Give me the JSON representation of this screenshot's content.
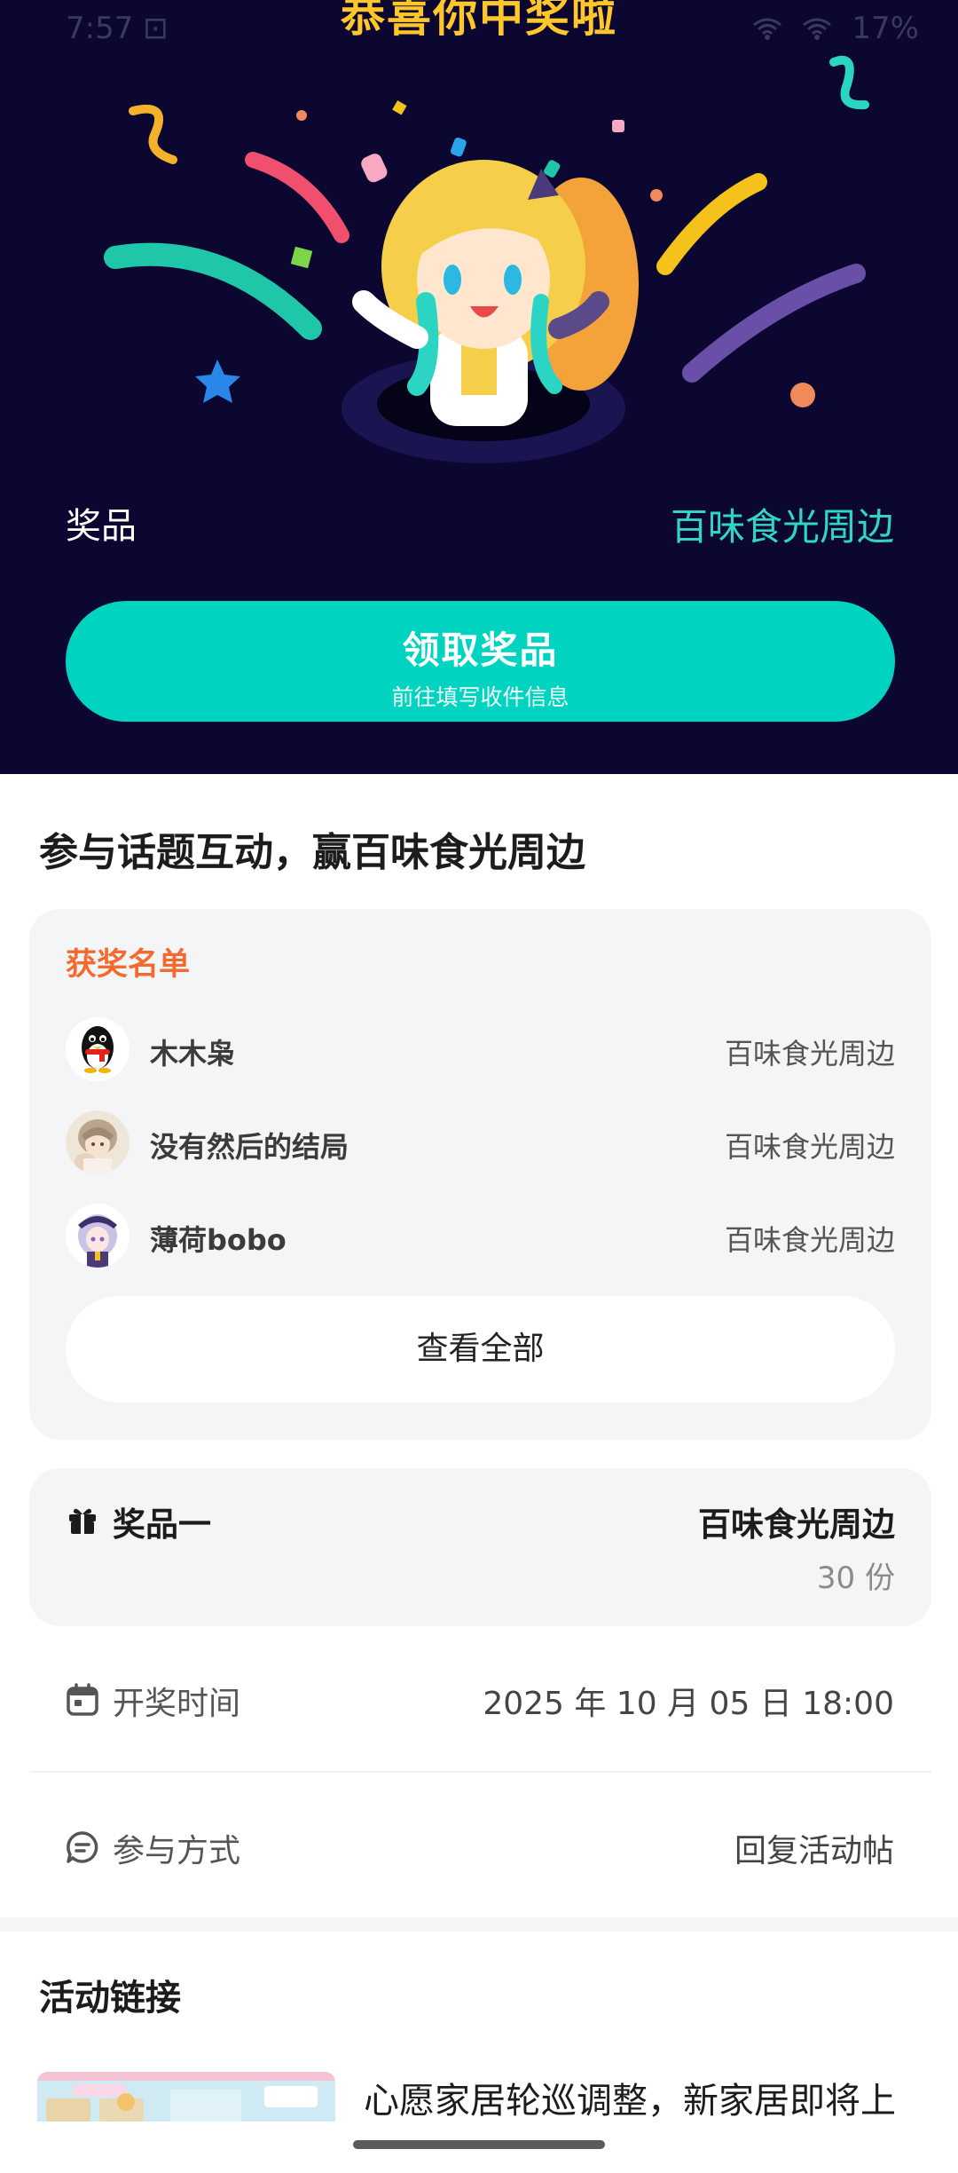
{
  "status_bar": {
    "time": "7:57 ⊡",
    "battery": "17%"
  },
  "hero": {
    "title": "恭喜你中奖啦",
    "prize_label": "奖品",
    "prize_name": "百味食光周边",
    "claim_button": {
      "title": "领取奖品",
      "subtitle": "前往填写收件信息"
    }
  },
  "topic": {
    "title": "参与话题互动，赢百味食光周边"
  },
  "winners": {
    "heading": "获奖名单",
    "items": [
      {
        "name": "木木枭",
        "prize": "百味食光周边",
        "avatar": "penguin-avatar"
      },
      {
        "name": "没有然后的结局",
        "prize": "百味食光周边",
        "avatar": "anime-boy-avatar"
      },
      {
        "name": "薄荷bobo",
        "prize": "百味食光周边",
        "avatar": "anime-girl-avatar"
      }
    ],
    "view_all": "查看全部"
  },
  "prize_card": {
    "icon": "gift-icon",
    "label": "奖品一",
    "name": "百味食光周边",
    "count": "30 份"
  },
  "draw_time": {
    "icon": "calendar-icon",
    "label": "开奖时间",
    "value": "2025 年 10 月 05 日 18:00"
  },
  "participation": {
    "icon": "chat-icon",
    "label": "参与方式",
    "value": "回复活动帖"
  },
  "links": {
    "title": "活动链接",
    "item": {
      "text": "心愿家居轮巡调整，新家居即将上"
    }
  },
  "colors": {
    "hero_bg": "#0b0730",
    "accent_teal": "#00d4c0",
    "prize_teal": "#2fd6c6",
    "title_gold": "#ffc72a",
    "winners_orange": "#f26a2d"
  }
}
